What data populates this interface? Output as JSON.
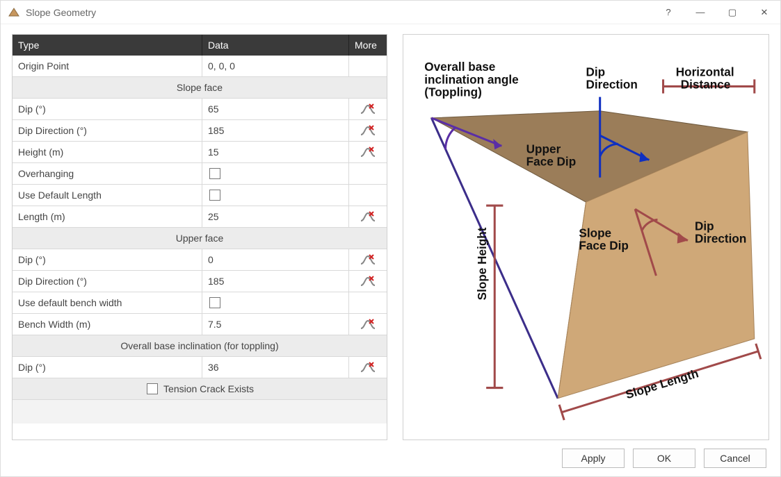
{
  "window": {
    "title": "Slope Geometry",
    "help_tip": "?",
    "minimize": "—",
    "maximize": "▢",
    "close": "✕"
  },
  "grid": {
    "headers": {
      "type": "Type",
      "data": "Data",
      "more": "More"
    },
    "origin": {
      "label": "Origin Point",
      "value": "0, 0, 0"
    },
    "sections": {
      "slope_face": "Slope face",
      "upper_face": "Upper face",
      "base_incl": "Overall base inclination (for toppling)"
    },
    "slope_face": {
      "dip": {
        "label": "Dip (°)",
        "value": "65"
      },
      "dip_dir": {
        "label": "Dip Direction (°)",
        "value": "185"
      },
      "height": {
        "label": "Height (m)",
        "value": "15"
      },
      "overhanging": {
        "label": "Overhanging",
        "checked": false
      },
      "use_def_len": {
        "label": "Use Default Length",
        "checked": false
      },
      "length": {
        "label": "Length (m)",
        "value": "25"
      }
    },
    "upper_face": {
      "dip": {
        "label": "Dip (°)",
        "value": "0"
      },
      "dip_dir": {
        "label": "Dip Direction (°)",
        "value": "185"
      },
      "use_def_bw": {
        "label": "Use default bench width",
        "checked": false
      },
      "bench_width": {
        "label": "Bench Width (m)",
        "value": "7.5"
      }
    },
    "base_incl": {
      "dip": {
        "label": "Dip (°)",
        "value": "36"
      }
    },
    "tension_crack": {
      "label": "Tension Crack Exists",
      "checked": false
    }
  },
  "diagram": {
    "label_topple": "Overall base\ninclination angle\n(Toppling)",
    "label_dipdir_top": "Dip\nDirection",
    "label_hdist": "Horizontal\nDistance",
    "label_upper_dip": "Upper\nFace Dip",
    "label_slope_dip": "Slope\nFace Dip",
    "label_dipdir_face": "Dip\nDirection",
    "label_height": "Slope Height",
    "label_length": "Slope Length"
  },
  "buttons": {
    "apply": "Apply",
    "ok": "OK",
    "cancel": "Cancel"
  }
}
